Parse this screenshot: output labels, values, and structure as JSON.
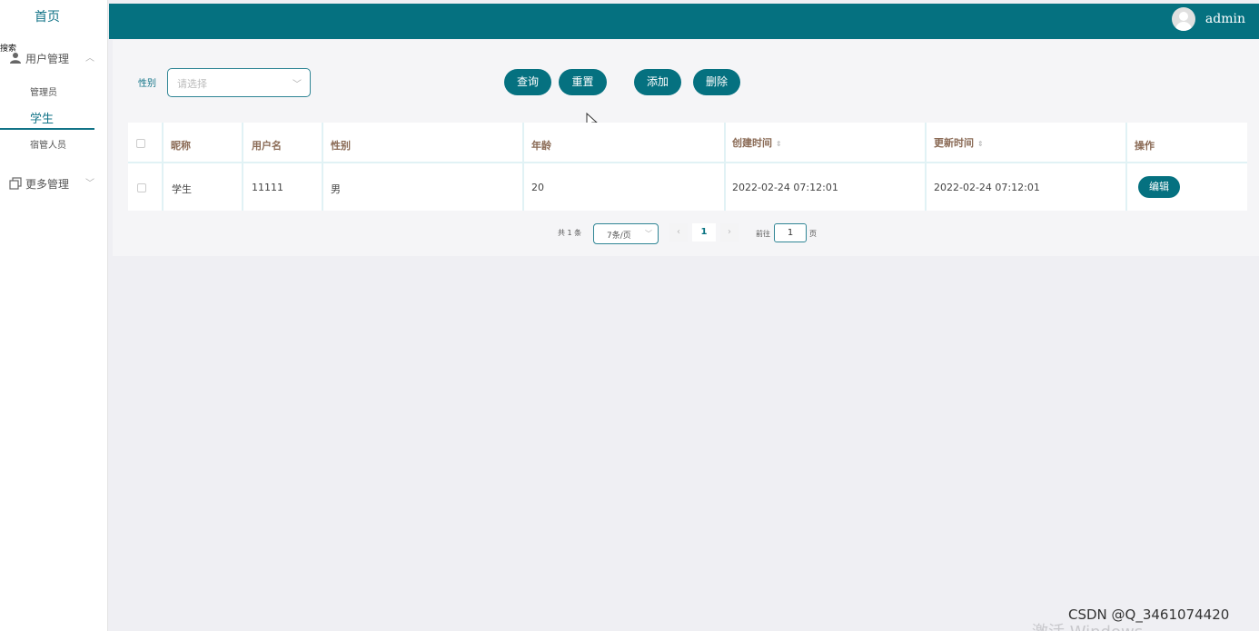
{
  "sidebar": {
    "home": "首页",
    "stray_text": "搜索",
    "groups": [
      {
        "label": "用户管理",
        "icon": "user-icon",
        "chevron": "^"
      },
      {
        "label": "更多管理",
        "icon": "copy-icon",
        "chevron": "v"
      }
    ],
    "items": [
      {
        "label": "管理员",
        "active": false
      },
      {
        "label": "学生",
        "active": true
      },
      {
        "label": "宿管人员",
        "active": false
      }
    ]
  },
  "header": {
    "username": "admin",
    "avatar_icon": "avatar-icon",
    "background": "#057180"
  },
  "filter": {
    "gender_label": "性别",
    "gender_placeholder": "请选择"
  },
  "toolbar": {
    "query": "查询",
    "reset": "重置",
    "add": "添加",
    "delete": "删除"
  },
  "table": {
    "columns": [
      "昵称",
      "用户名",
      "性别",
      "年龄",
      "创建时间",
      "更新时间",
      "操作"
    ],
    "sort_glyph": "⇕",
    "rows": [
      {
        "nickname": "学生",
        "username": "11111",
        "gender": "男",
        "age": "20",
        "created": "2022-02-24 07:12:01",
        "updated": "2022-02-24 07:12:01",
        "action": "编辑"
      }
    ]
  },
  "pagination": {
    "total": "共 1 条",
    "page_size": "7条/页",
    "current_page": "1",
    "goto_prefix": "前往",
    "goto_value": "1",
    "goto_suffix": "页"
  },
  "watermark": "CSDN @Q_3461074420",
  "os_overlay": "激活 Windows",
  "accent_color": "#057180"
}
